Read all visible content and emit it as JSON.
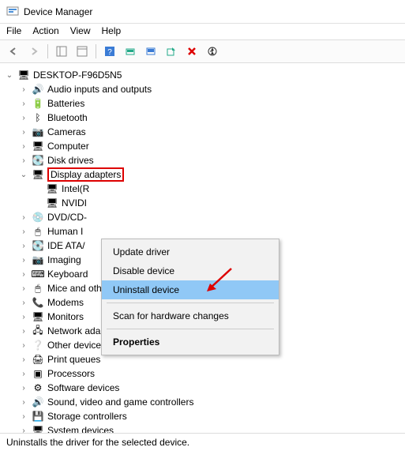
{
  "window": {
    "title": "Device Manager"
  },
  "menu": {
    "file": "File",
    "action": "Action",
    "view": "View",
    "help": "Help"
  },
  "tree": {
    "root": "DESKTOP-F96D5N5",
    "items": [
      {
        "label": "Audio inputs and outputs",
        "icon": "🔊"
      },
      {
        "label": "Batteries",
        "icon": "🔋"
      },
      {
        "label": "Bluetooth",
        "icon": "ᛒ"
      },
      {
        "label": "Cameras",
        "icon": "📷"
      },
      {
        "label": "Computer",
        "icon": "🖥"
      },
      {
        "label": "Disk drives",
        "icon": "💽"
      }
    ],
    "display_adapters": {
      "label": "Display adapters",
      "icon": "🖥",
      "child0": "Intel(R",
      "child1": "NVIDI"
    },
    "after": [
      {
        "label": "DVD/CD-",
        "icon": "💿"
      },
      {
        "label": "Human I",
        "icon": "🖱"
      },
      {
        "label": "IDE ATA/",
        "icon": "💽"
      },
      {
        "label": "Imaging ",
        "icon": "📷"
      },
      {
        "label": "Keyboard",
        "icon": "⌨"
      },
      {
        "label": "Mice and other pointing devices",
        "icon": "🖱"
      },
      {
        "label": "Modems",
        "icon": "📞"
      },
      {
        "label": "Monitors",
        "icon": "🖥"
      },
      {
        "label": "Network adapters",
        "icon": "🖧"
      },
      {
        "label": "Other devices",
        "icon": "❔"
      },
      {
        "label": "Print queues",
        "icon": "🖨"
      },
      {
        "label": "Processors",
        "icon": "▣"
      },
      {
        "label": "Software devices",
        "icon": "⚙"
      },
      {
        "label": "Sound, video and game controllers",
        "icon": "🔊"
      },
      {
        "label": "Storage controllers",
        "icon": "💾"
      },
      {
        "label": "System devices",
        "icon": "🖥"
      }
    ]
  },
  "context_menu": {
    "update": "Update driver",
    "disable": "Disable device",
    "uninstall": "Uninstall device",
    "scan": "Scan for hardware changes",
    "properties": "Properties"
  },
  "status": "Uninstalls the driver for the selected device."
}
